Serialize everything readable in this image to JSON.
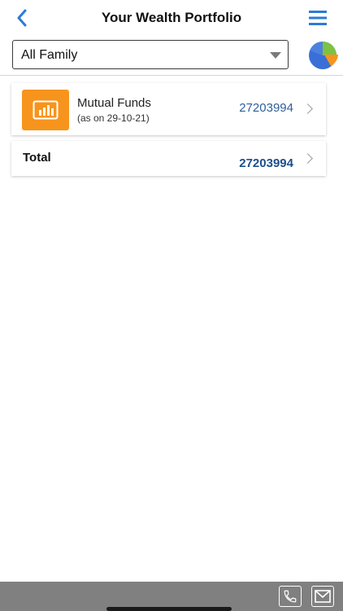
{
  "header": {
    "title": "Your Wealth Portfolio",
    "back_icon": "chevron-left-icon",
    "menu_icon": "hamburger-menu-icon",
    "accent_color": "#2b7bd6"
  },
  "filter": {
    "selected": "All Family",
    "chart_icon": "pie-chart-icon"
  },
  "holdings": [
    {
      "name": "Mutual Funds",
      "date": "(as on 29-10-21)",
      "value": "27203994",
      "icon": "bar-chart-icon",
      "icon_bg": "#f7941d"
    }
  ],
  "total": {
    "label": "Total",
    "value": "27203994"
  },
  "footer": {
    "call_icon": "phone-icon",
    "mail_icon": "mail-icon",
    "bar_color": "#808080"
  }
}
